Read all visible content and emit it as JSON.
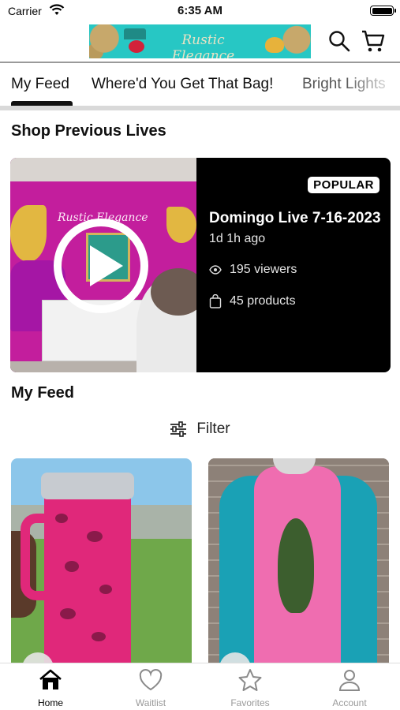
{
  "status_bar": {
    "carrier": "Carrier",
    "time": "6:35 AM"
  },
  "header": {
    "brand_logo_text": "Rustic Elegance",
    "icons": [
      "search-icon",
      "cart-icon"
    ]
  },
  "tabs": [
    {
      "label": "My Feed",
      "active": true
    },
    {
      "label": "Where'd You Get That Bag!",
      "active": false
    },
    {
      "label": "Bright Lights",
      "active": false
    }
  ],
  "shop_previous": {
    "section_title": "Shop Previous Lives",
    "live": {
      "badge": "POPULAR",
      "title": "Domingo Live 7-16-2023",
      "ago": "1d 1h ago",
      "viewers": "195 viewers",
      "products": "45 products",
      "thumb_sign": "Rustic Elegance"
    }
  },
  "feed": {
    "section_title": "My Feed",
    "filter_label": "Filter"
  },
  "bottom_nav": [
    {
      "label": "Home",
      "icon": "home-icon",
      "active": true
    },
    {
      "label": "Waitlist",
      "icon": "heart-icon",
      "active": false
    },
    {
      "label": "Favorites",
      "icon": "star-icon",
      "active": false
    },
    {
      "label": "Account",
      "icon": "account-icon",
      "active": false
    }
  ],
  "colors": {
    "logo_bg": "#27c7c4",
    "live_card_bg": "#000000",
    "active_tab": "#111111",
    "inactive_nav": "#9a9a9a"
  }
}
